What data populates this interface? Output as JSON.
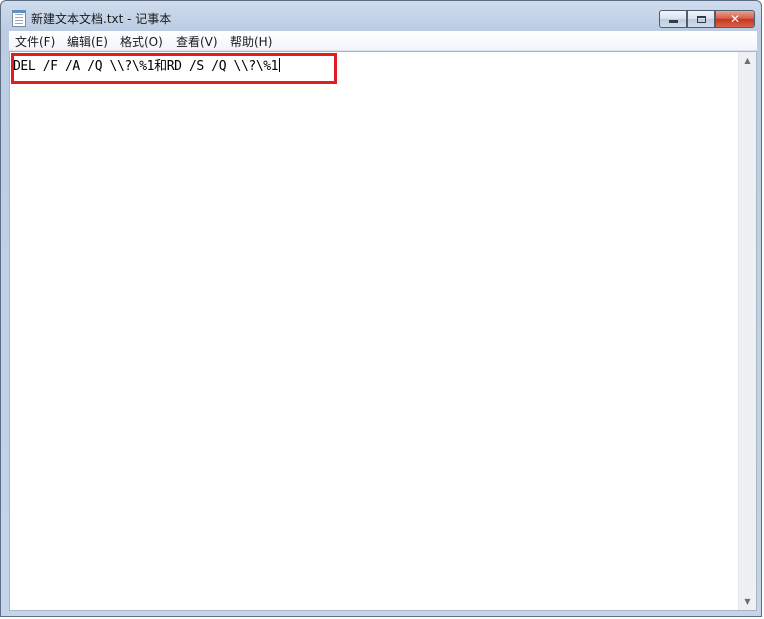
{
  "window": {
    "title": "新建文本文档.txt - 记事本"
  },
  "caption_buttons": {
    "close_label": "✕"
  },
  "menu": {
    "items": [
      {
        "label": "文件(F)"
      },
      {
        "label": "编辑(E)"
      },
      {
        "label": "格式(O)"
      },
      {
        "label": "查看(V)"
      },
      {
        "label": "帮助(H)"
      }
    ]
  },
  "editor": {
    "content": "DEL /F /A /Q \\\\?\\%1和RD /S /Q \\\\?\\%1"
  },
  "scrollbar": {
    "up_arrow": "▲",
    "down_arrow": "▼"
  },
  "colors": {
    "highlight_border": "#e31b23",
    "close_button": "#c2361e"
  },
  "icons": {
    "app": "notepad-icon",
    "minimize": "minimize-icon",
    "maximize": "maximize-icon",
    "close": "close-icon"
  }
}
